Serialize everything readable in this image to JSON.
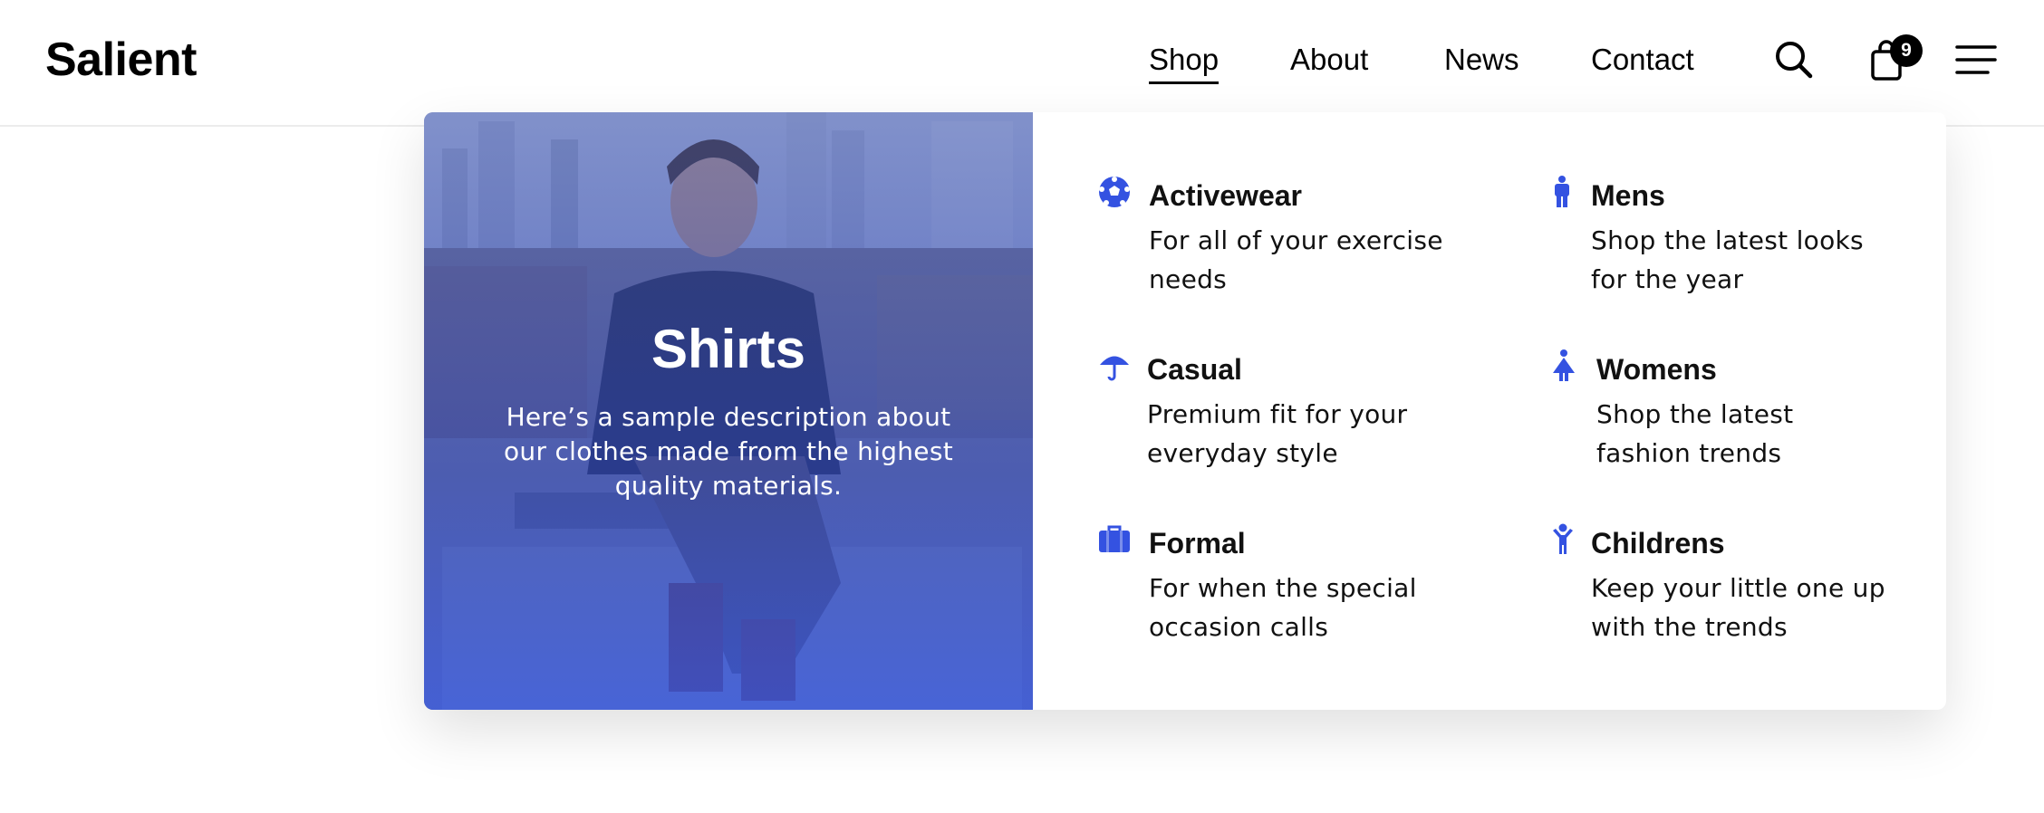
{
  "brand": {
    "name": "Salient"
  },
  "nav": {
    "items": [
      {
        "label": "Shop",
        "active": true
      },
      {
        "label": "About",
        "active": false
      },
      {
        "label": "News",
        "active": false
      },
      {
        "label": "Contact",
        "active": false
      }
    ]
  },
  "header_icons": {
    "search": "search-icon",
    "cart": "shopping-bag-icon",
    "cart_count": "9",
    "menu": "hamburger-menu-icon"
  },
  "mega_menu": {
    "feature": {
      "title": "Shirts",
      "description": "Here’s a sample description about our clothes made from the highest quality materials."
    },
    "categories": [
      {
        "title": "Activewear",
        "description": "For all of your exercise needs",
        "icon": "soccer-ball-icon"
      },
      {
        "title": "Mens",
        "description": "Shop the latest looks for the year",
        "icon": "male-figure-icon"
      },
      {
        "title": "Casual",
        "description": "Premium fit for your everyday style",
        "icon": "umbrella-icon"
      },
      {
        "title": "Womens",
        "description": "Shop the latest fashion trends",
        "icon": "female-figure-icon"
      },
      {
        "title": "Formal",
        "description": "For when the special occasion calls",
        "icon": "briefcase-icon"
      },
      {
        "title": "Childrens",
        "description": "Keep your little one up with the trends",
        "icon": "child-figure-icon"
      }
    ],
    "icon_color": "#3452e1"
  },
  "colors": {
    "accent": "#3452e1",
    "text": "#111111",
    "badge": "#000000"
  }
}
